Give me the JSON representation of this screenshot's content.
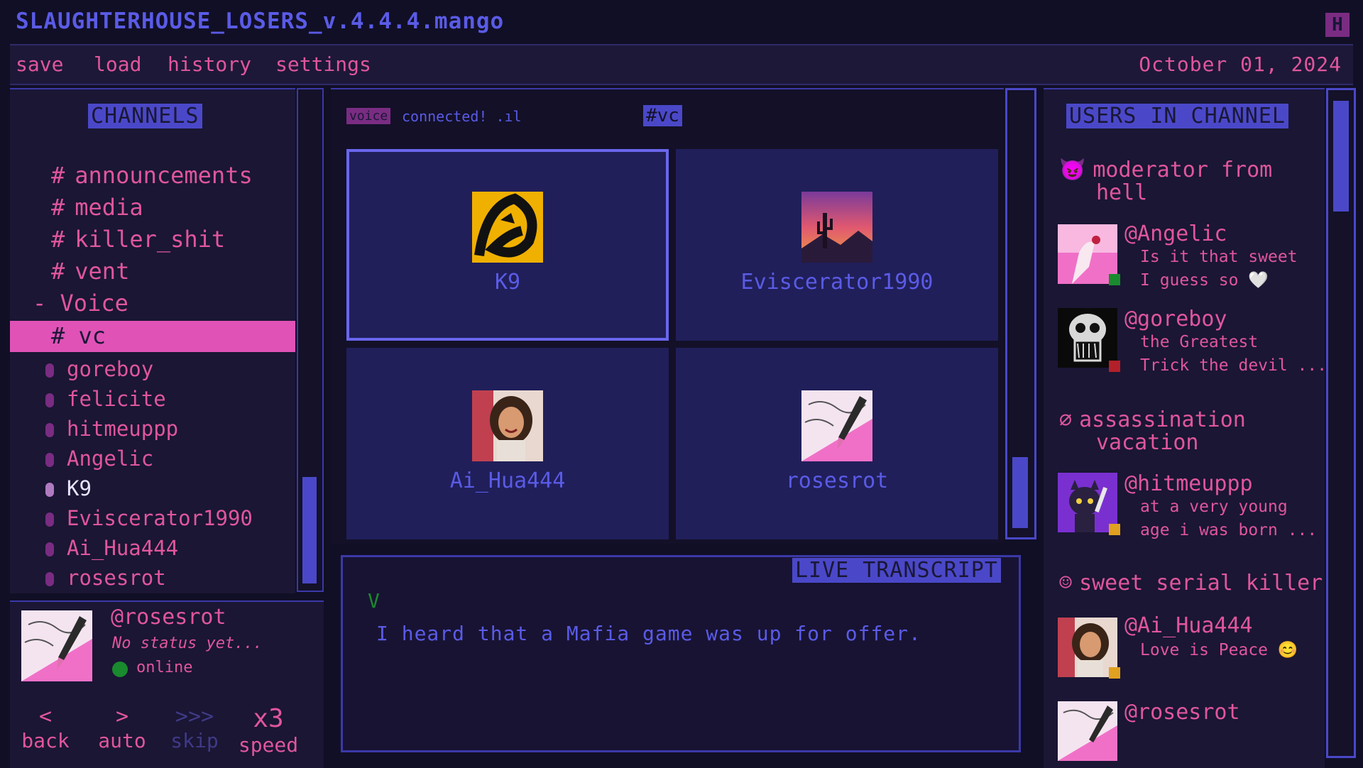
{
  "app": {
    "title": "SLAUGHTERHOUSE_LOSERS_v.4.4.4.mango",
    "close_label": "H"
  },
  "menu": {
    "items": [
      "save",
      "load",
      "history",
      "settings"
    ],
    "date": "October 01, 2024"
  },
  "channels": {
    "header": "CHANNELS",
    "text_channels": [
      "announcements",
      "media",
      "killer_shit",
      "vent"
    ],
    "hash": "#",
    "voice_group": "- Voice",
    "active_channel": "vc",
    "members": [
      "goreboy",
      "felicite",
      "hitmeuppp",
      "Angelic",
      "K9",
      "Eviscerator1990",
      "Ai_Hua444",
      "rosesrot"
    ]
  },
  "profile": {
    "handle": "@rosesrot",
    "status": "No status yet...",
    "presence": "online"
  },
  "controls": [
    {
      "symbol": "<",
      "label": "back"
    },
    {
      "symbol": ">",
      "label": "auto"
    },
    {
      "symbol": ">>>",
      "label": "skip"
    },
    {
      "symbol": "x3",
      "label": "speed"
    }
  ],
  "voice": {
    "tag": "voice",
    "connected": "connected! .ıl",
    "channel_tag": "#vc"
  },
  "tiles": [
    {
      "name": "K9"
    },
    {
      "name": "Eviscerator1990"
    },
    {
      "name": "Ai_Hua444"
    },
    {
      "name": "rosesrot"
    }
  ],
  "transcript": {
    "header": "LIVE TRANSCRIPT",
    "speaker": "V",
    "text": "I heard that a Mafia game was up for offer."
  },
  "users": {
    "header": "USERS IN CHANNEL",
    "roles": [
      {
        "icon": "devil-icon",
        "glyph": "😈",
        "line1": "moderator from",
        "line2": "hell"
      },
      {
        "icon": "empty-set-icon",
        "glyph": "∅",
        "line1": "assassination",
        "line2": "vacation"
      },
      {
        "icon": "smile-icon",
        "glyph": "☺",
        "line1": "sweet serial killer",
        "line2": ""
      }
    ],
    "list": [
      {
        "handle": "@Angelic",
        "msg1": "Is it that sweet",
        "msg2": "I guess so 🤍",
        "status_color": "#1a8a2e"
      },
      {
        "handle": "@goreboy",
        "msg1": "the Greatest",
        "msg2": "Trick the devil ...",
        "status_color": "#b3202a"
      },
      {
        "handle": "@hitmeuppp",
        "msg1": "at a very young",
        "msg2": "age i was born ...",
        "status_color": "#e0a020"
      },
      {
        "handle": "@Ai_Hua444",
        "msg1": "Love is Peace 😊",
        "msg2": "",
        "status_color": "#e0a020"
      },
      {
        "handle": "@rosesrot",
        "msg1": "",
        "msg2": "",
        "status_color": ""
      }
    ]
  },
  "colors": {
    "accent_pink": "#e0569c",
    "accent_blue": "#5a5be6",
    "online": "#1a8a2e",
    "dnd": "#b3202a",
    "idle": "#e0a020"
  }
}
